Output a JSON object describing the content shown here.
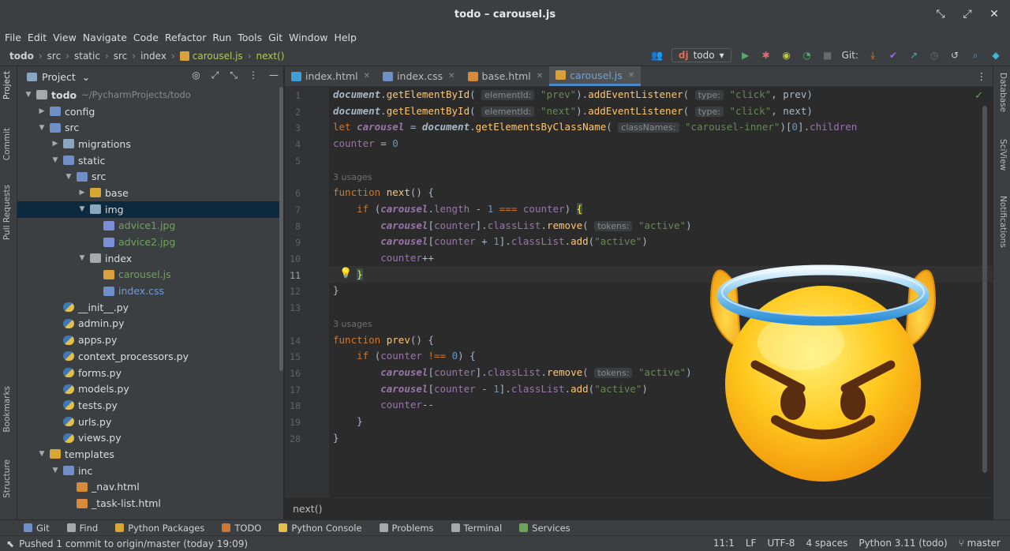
{
  "window": {
    "title": "todo – carousel.js"
  },
  "menu": [
    "File",
    "Edit",
    "View",
    "Navigate",
    "Code",
    "Refactor",
    "Run",
    "Tools",
    "Git",
    "Window",
    "Help"
  ],
  "breadcrumb": [
    "todo",
    "src",
    "static",
    "src",
    "index",
    "carousel.js",
    "next()"
  ],
  "toolbar": {
    "run_config": "todo",
    "git_label": "Git:"
  },
  "left_tabs": [
    "Project",
    "Commit",
    "Pull Requests",
    "Bookmarks",
    "Structure"
  ],
  "right_tabs": [
    "Database",
    "SciView",
    "Notifications"
  ],
  "project": {
    "title": "Project",
    "tree": [
      {
        "indent": 0,
        "arrow": "▾",
        "icon": "folder-grey",
        "label": "todo",
        "note": "~/PycharmProjects/todo",
        "style": "bold"
      },
      {
        "indent": 1,
        "arrow": "▸",
        "icon": "folder-blue",
        "label": "config"
      },
      {
        "indent": 1,
        "arrow": "▾",
        "icon": "folder-blue",
        "label": "src"
      },
      {
        "indent": 2,
        "arrow": "▸",
        "icon": "folder",
        "label": "migrations"
      },
      {
        "indent": 2,
        "arrow": "▾",
        "icon": "folder-blue",
        "label": "static"
      },
      {
        "indent": 3,
        "arrow": "▾",
        "icon": "folder-blue",
        "label": "src"
      },
      {
        "indent": 4,
        "arrow": "▸",
        "icon": "folder-yellow",
        "label": "base"
      },
      {
        "indent": 4,
        "arrow": "▾",
        "icon": "folder",
        "label": "img",
        "selected": true
      },
      {
        "indent": 5,
        "arrow": "",
        "icon": "img",
        "label": "advice1.jpg",
        "style": "green"
      },
      {
        "indent": 5,
        "arrow": "",
        "icon": "img",
        "label": "advice2.jpg",
        "style": "green"
      },
      {
        "indent": 4,
        "arrow": "▾",
        "icon": "folder-grey",
        "label": "index"
      },
      {
        "indent": 5,
        "arrow": "",
        "icon": "js",
        "label": "carousel.js",
        "style": "green"
      },
      {
        "indent": 5,
        "arrow": "",
        "icon": "css",
        "label": "index.css",
        "style": "blue"
      },
      {
        "indent": 2,
        "arrow": "",
        "icon": "py",
        "label": "__init__.py"
      },
      {
        "indent": 2,
        "arrow": "",
        "icon": "py",
        "label": "admin.py"
      },
      {
        "indent": 2,
        "arrow": "",
        "icon": "py",
        "label": "apps.py"
      },
      {
        "indent": 2,
        "arrow": "",
        "icon": "py",
        "label": "context_processors.py"
      },
      {
        "indent": 2,
        "arrow": "",
        "icon": "py",
        "label": "forms.py"
      },
      {
        "indent": 2,
        "arrow": "",
        "icon": "py",
        "label": "models.py"
      },
      {
        "indent": 2,
        "arrow": "",
        "icon": "py",
        "label": "tests.py"
      },
      {
        "indent": 2,
        "arrow": "",
        "icon": "py",
        "label": "urls.py"
      },
      {
        "indent": 2,
        "arrow": "",
        "icon": "py",
        "label": "views.py"
      },
      {
        "indent": 1,
        "arrow": "▾",
        "icon": "folder-yellow",
        "label": "templates"
      },
      {
        "indent": 2,
        "arrow": "▾",
        "icon": "folder-blue",
        "label": "inc"
      },
      {
        "indent": 3,
        "arrow": "",
        "icon": "html",
        "label": "_nav.html"
      },
      {
        "indent": 3,
        "arrow": "",
        "icon": "html",
        "label": "_task-list.html"
      }
    ]
  },
  "tabs": [
    {
      "label": "index.html",
      "icon": "#3f9fd6",
      "active": false
    },
    {
      "label": "index.css",
      "icon": "#6f8fc9",
      "active": false
    },
    {
      "label": "base.html",
      "icon": "#d88a3b",
      "active": false
    },
    {
      "label": "carousel.js",
      "icon": "#d9a13b",
      "active": true
    }
  ],
  "code": {
    "line_numbers": [
      "1",
      "2",
      "3",
      "4",
      "5",
      "",
      "6",
      "7",
      "8",
      "9",
      "10",
      "11",
      "12",
      "13",
      "",
      "14",
      "15",
      "16",
      "17",
      "18",
      "19",
      "28"
    ],
    "usages_label": "3 usages",
    "function_crumb": "next()"
  },
  "toolwindows": [
    {
      "label": "Git",
      "color": "#6f8fc9"
    },
    {
      "label": "Find",
      "color": "#a8a8a8"
    },
    {
      "label": "Python Packages",
      "color": "#d8a634"
    },
    {
      "label": "TODO",
      "color": "#cc7832"
    },
    {
      "label": "Python Console",
      "color": "#e2c04a"
    },
    {
      "label": "Problems",
      "color": "#a8a8a8"
    },
    {
      "label": "Terminal",
      "color": "#a8a8a8"
    },
    {
      "label": "Services",
      "color": "#6fa25e"
    }
  ],
  "status": {
    "message": "Pushed 1 commit to origin/master (today 19:09)",
    "position": "11:1",
    "line_sep": "LF",
    "encoding": "UTF-8",
    "indent": "4 spaces",
    "interpreter": "Python 3.11 (todo)",
    "branch": "master"
  }
}
